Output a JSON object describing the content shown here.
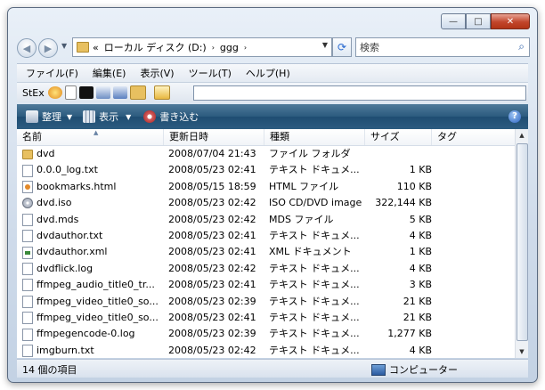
{
  "window": {
    "controls": {
      "minimize": "—",
      "maximize": "□",
      "close": "✕"
    }
  },
  "nav": {
    "address": {
      "prefix": "«",
      "crumbs": [
        "ローカル ディスク (D:)",
        "ggg"
      ],
      "separator": "›"
    },
    "search_placeholder": "検索"
  },
  "menubar": {
    "items": [
      "ファイル(F)",
      "編集(E)",
      "表示(V)",
      "ツール(T)",
      "ヘルプ(H)"
    ]
  },
  "stex": {
    "label": "StEx"
  },
  "cmdbar": {
    "organize": "整理",
    "view": "表示",
    "burn": "書き込む",
    "help": "?"
  },
  "columns": {
    "name": "名前",
    "date": "更新日時",
    "type": "種類",
    "size": "サイズ",
    "tag": "タグ"
  },
  "files": [
    {
      "icon": "folder",
      "name": "dvd",
      "date": "2008/07/04 21:43",
      "type": "ファイル フォルダ",
      "size": ""
    },
    {
      "icon": "doc",
      "name": "0.0.0_log.txt",
      "date": "2008/05/23 02:41",
      "type": "テキスト ドキュメ...",
      "size": "1 KB"
    },
    {
      "icon": "html",
      "name": "bookmarks.html",
      "date": "2008/05/15 18:59",
      "type": "HTML ファイル",
      "size": "110 KB"
    },
    {
      "icon": "disc",
      "name": "dvd.iso",
      "date": "2008/05/23 02:42",
      "type": "ISO CD/DVD image",
      "size": "322,144 KB"
    },
    {
      "icon": "doc",
      "name": "dvd.mds",
      "date": "2008/05/23 02:42",
      "type": "MDS ファイル",
      "size": "5 KB"
    },
    {
      "icon": "doc",
      "name": "dvdauthor.txt",
      "date": "2008/05/23 02:41",
      "type": "テキスト ドキュメ...",
      "size": "4 KB"
    },
    {
      "icon": "xml",
      "name": "dvdauthor.xml",
      "date": "2008/05/23 02:41",
      "type": "XML ドキュメント",
      "size": "1 KB"
    },
    {
      "icon": "doc",
      "name": "dvdflick.log",
      "date": "2008/05/23 02:42",
      "type": "テキスト ドキュメ...",
      "size": "4 KB"
    },
    {
      "icon": "doc",
      "name": "ffmpeg_audio_title0_tr...",
      "date": "2008/05/23 02:41",
      "type": "テキスト ドキュメ...",
      "size": "3 KB"
    },
    {
      "icon": "doc",
      "name": "ffmpeg_video_title0_so...",
      "date": "2008/05/23 02:39",
      "type": "テキスト ドキュメ...",
      "size": "21 KB"
    },
    {
      "icon": "doc",
      "name": "ffmpeg_video_title0_so...",
      "date": "2008/05/23 02:41",
      "type": "テキスト ドキュメ...",
      "size": "21 KB"
    },
    {
      "icon": "doc",
      "name": "ffmpegencode-0.log",
      "date": "2008/05/23 02:39",
      "type": "テキスト ドキュメ...",
      "size": "1,277 KB"
    },
    {
      "icon": "doc",
      "name": "imgburn.txt",
      "date": "2008/05/23 02:42",
      "type": "テキスト ドキュメ...",
      "size": "4 KB"
    }
  ],
  "status": {
    "count": "14 個の項目",
    "location": "コンピューター"
  }
}
